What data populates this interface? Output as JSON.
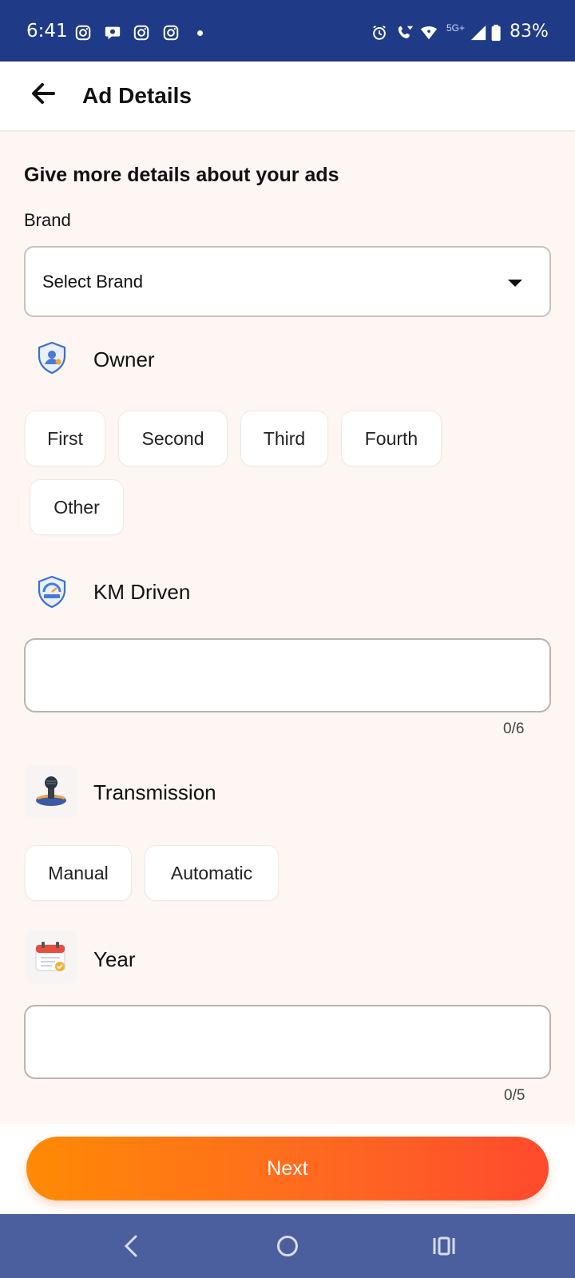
{
  "status_bar": {
    "time": "6:41",
    "network": "5G+",
    "battery": "83%",
    "notification_icons": [
      "instagram-icon",
      "chat-bubble-icon",
      "instagram-icon",
      "instagram-icon"
    ],
    "system_icons": [
      "alarm-icon",
      "wifi-call-icon",
      "wifi-icon",
      "signal-icon",
      "battery-icon"
    ]
  },
  "app_bar": {
    "title": "Ad Details"
  },
  "form": {
    "heading": "Give more details about your ads",
    "brand": {
      "label": "Brand",
      "selected": "Select Brand"
    },
    "owner": {
      "title": "Owner",
      "options": [
        "First",
        "Second",
        "Third",
        "Fourth",
        "Other"
      ]
    },
    "km_driven": {
      "title": "KM Driven",
      "value": "",
      "counter": "0/6"
    },
    "transmission": {
      "title": "Transmission",
      "options": [
        "Manual",
        "Automatic"
      ]
    },
    "year": {
      "title": "Year",
      "value": "",
      "counter": "0/5"
    }
  },
  "actions": {
    "next_label": "Next"
  },
  "colors": {
    "status_bar": "#1f3b88",
    "background": "#fdf6f3",
    "accent_start": "#ff8a05",
    "accent_end": "#ff4a2e",
    "nav_bar": "#4b5f9e"
  }
}
